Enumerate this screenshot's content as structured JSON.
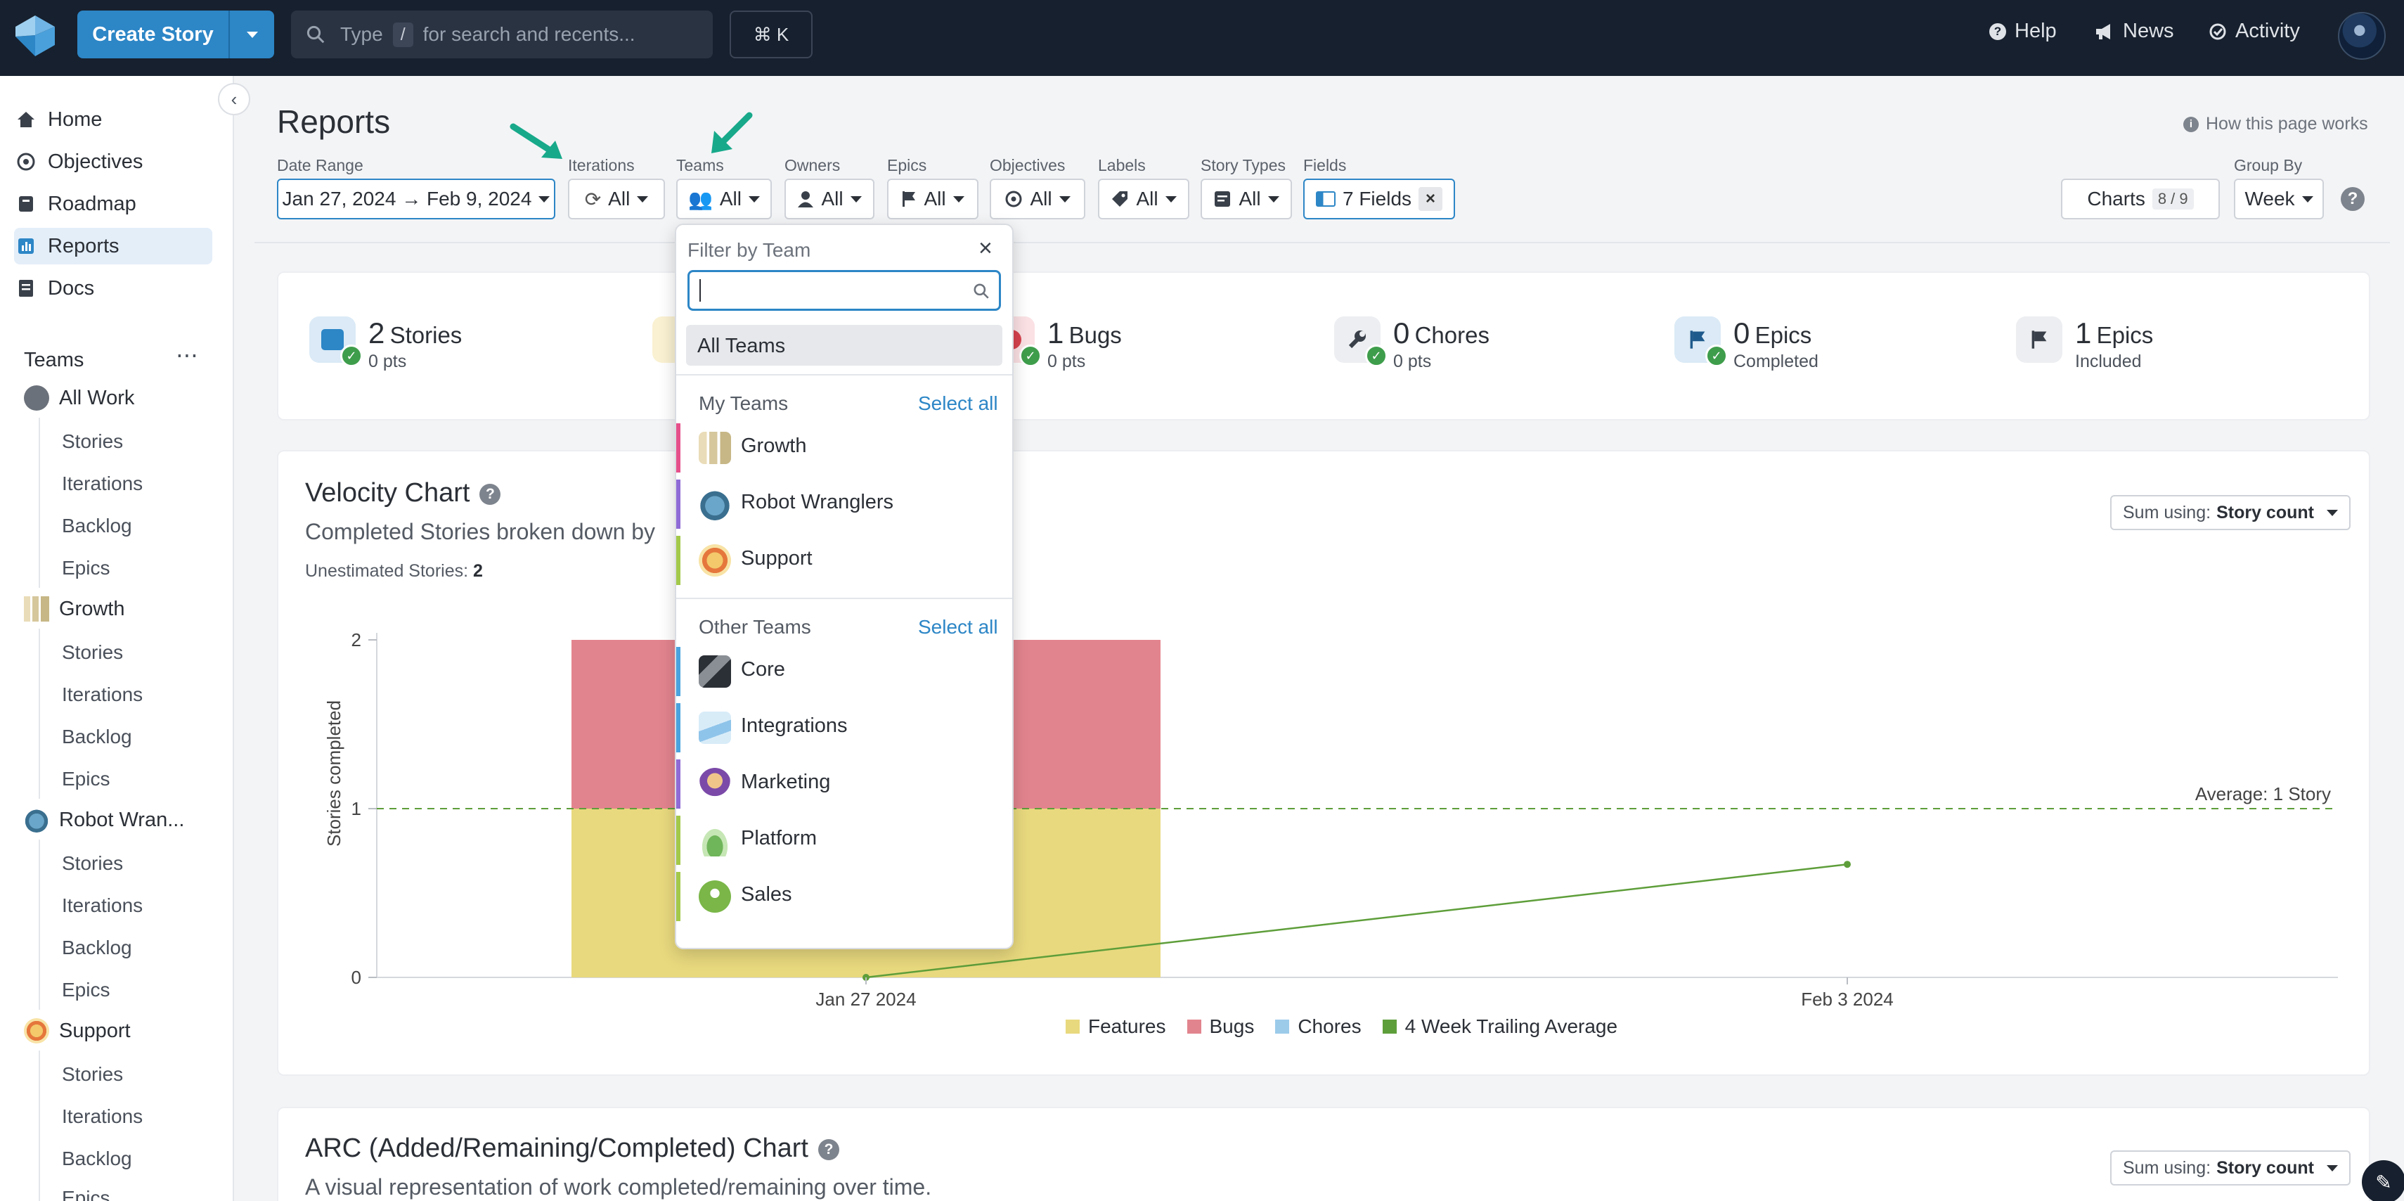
{
  "topbar": {
    "create_story": "Create Story",
    "search_placeholder_pre": "Type",
    "search_key": "/",
    "search_placeholder_post": "for search and recents...",
    "shortcut": "⌘ K",
    "help": "Help",
    "news": "News",
    "activity": "Activity"
  },
  "sidebar": {
    "nav": [
      "Home",
      "Objectives",
      "Roadmap",
      "Reports",
      "Docs"
    ],
    "teams_title": "Teams",
    "all_work": "All Work",
    "teams": [
      "Growth",
      "Robot Wran..."
    ],
    "support": "Support",
    "sub": [
      "Stories",
      "Iterations",
      "Backlog",
      "Epics"
    ],
    "last_partial": "Epics"
  },
  "page": {
    "title": "Reports",
    "how_it_works": "How this page works"
  },
  "filters": {
    "date_range": {
      "label": "Date Range",
      "value": "Jan 27, 2024 → Feb 9, 2024"
    },
    "iterations": {
      "label": "Iterations",
      "value": "All"
    },
    "teams": {
      "label": "Teams",
      "value": "All"
    },
    "owners": {
      "label": "Owners",
      "value": "All"
    },
    "epics": {
      "label": "Epics",
      "value": "All"
    },
    "objectives": {
      "label": "Objectives",
      "value": "All"
    },
    "labels": {
      "label": "Labels",
      "value": "All"
    },
    "story_types": {
      "label": "Story Types",
      "value": "All"
    },
    "fields": {
      "label": "Fields",
      "value": "7 Fields"
    },
    "charts": {
      "label": "Charts",
      "count": "8 / 9"
    },
    "group_by": {
      "label": "Group By",
      "value": "Week"
    }
  },
  "stats": [
    {
      "num": "2",
      "unit": "Stories",
      "sub": "0 pts"
    },
    {
      "num": "1",
      "unit": "Bugs",
      "sub": "0 pts"
    },
    {
      "num": "0",
      "unit": "Chores",
      "sub": "0 pts"
    },
    {
      "num": "0",
      "unit": "Epics",
      "sub": "Completed"
    },
    {
      "num": "1",
      "unit": "Epics",
      "sub": "Included"
    }
  ],
  "velocity": {
    "title": "Velocity Chart",
    "subtitle": "Completed Stories broken down by",
    "unestimated_label": "Unestimated Stories:",
    "unestimated_value": "2",
    "sum_label": "Sum using:",
    "sum_value": "Story count",
    "average_label": "Average: 1 Story"
  },
  "chart_data": {
    "type": "bar",
    "categories": [
      "Jan 27 2024",
      "Feb 3 2024"
    ],
    "series": [
      {
        "name": "Features",
        "values": [
          1,
          0
        ],
        "color": "#e8d97e"
      },
      {
        "name": "Bugs",
        "values": [
          1,
          0
        ],
        "color": "#e2848e"
      },
      {
        "name": "Chores",
        "values": [
          0,
          0
        ],
        "color": "#9ccbea"
      }
    ],
    "trailing_average": {
      "name": "4 Week Trailing Average",
      "values": [
        0,
        0.67
      ],
      "color": "#5e9e3a"
    },
    "average": 1,
    "ylabel": "Stories completed",
    "ylim": [
      0,
      2
    ],
    "yticks": [
      "0",
      "1",
      "2"
    ],
    "legend_position": "bottom"
  },
  "arc": {
    "title": "ARC (Added/Remaining/Completed) Chart",
    "subtitle": "A visual representation of work completed/remaining over time.",
    "sum_label": "Sum using:",
    "sum_value": "Story count"
  },
  "team_filter": {
    "title": "Filter by Team",
    "all_teams": "All Teams",
    "my_teams_label": "My Teams",
    "other_teams_label": "Other Teams",
    "select_all": "Select all",
    "my_teams": [
      {
        "name": "Growth",
        "color": "#e6508a"
      },
      {
        "name": "Robot Wranglers",
        "color": "#8e6bd6"
      },
      {
        "name": "Support",
        "color": "#a3c94a"
      }
    ],
    "other_teams": [
      {
        "name": "Core",
        "color": "#4aa3df"
      },
      {
        "name": "Integrations",
        "color": "#4aa3df"
      },
      {
        "name": "Marketing",
        "color": "#8e6bd6"
      },
      {
        "name": "Platform",
        "color": "#a3c94a"
      },
      {
        "name": "Sales",
        "color": "#a3c94a"
      }
    ]
  }
}
